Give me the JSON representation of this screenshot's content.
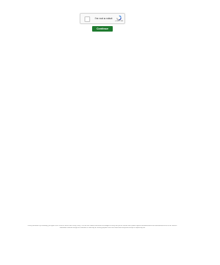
{
  "captcha": {
    "checkbox_label": "I'm not a robot",
    "brand": "reCAPTCHA",
    "icon": "recaptcha-icon",
    "accent_color": "#4a90e2"
  },
  "continue_button": {
    "label": "Continue",
    "color": "#1e7a2f"
  },
  "footer": {
    "line1": "Privacy disclosure: by continuing, you agree to our Terms of Service and Privacy Policy. This site uses cookies and similar technologies to verify that you are human and to protect against automated abuse and unauthorized access to our services.",
    "line2": "Information collected through this verification is used only for security purposes and is not shared with third parties except as required by law."
  }
}
